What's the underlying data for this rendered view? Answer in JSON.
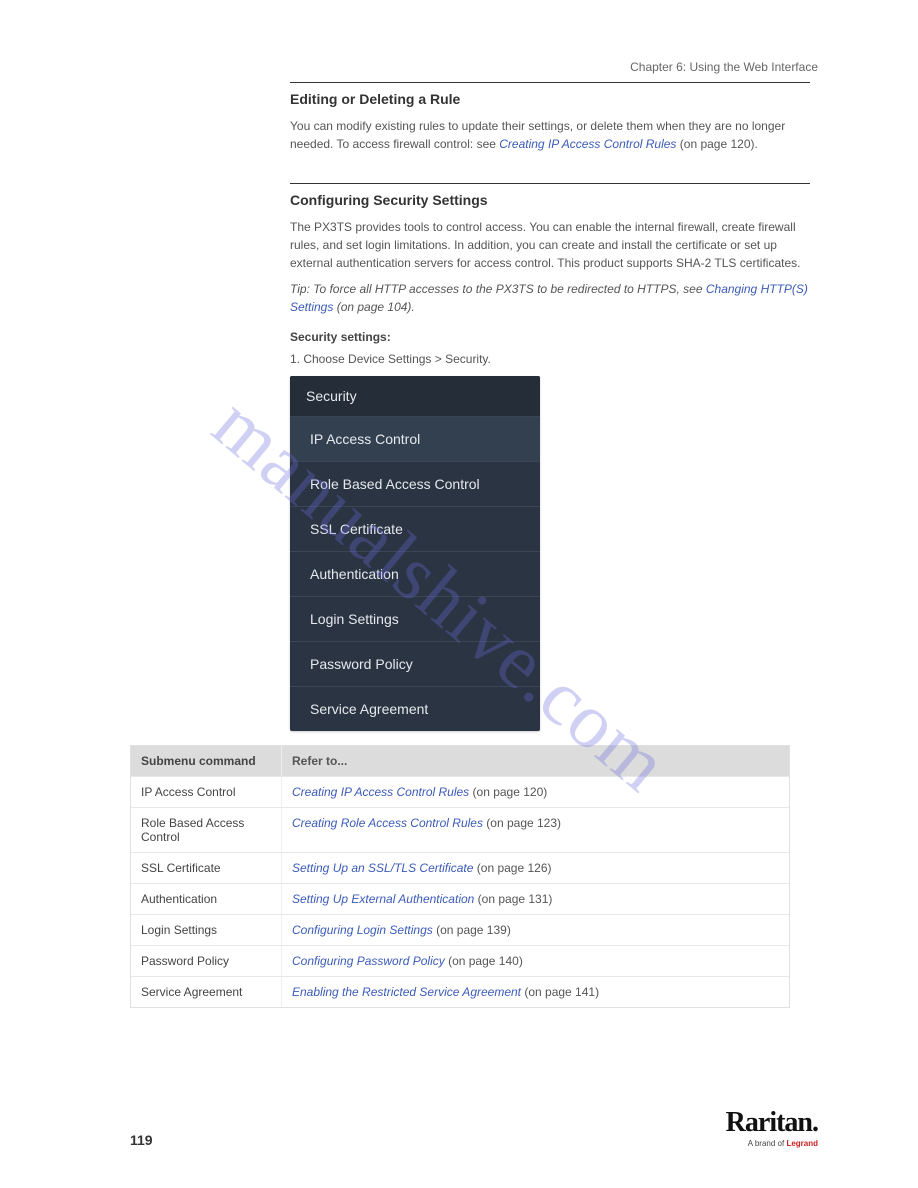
{
  "chapter_label": "Chapter 6: Using the Web Interface",
  "top_empty": "",
  "section1": {
    "title": "Editing or Deleting a Rule",
    "body_prefix": "You can modify existing rules to update their settings, or delete them when they are no longer needed.",
    "body_see": "To access firewall control: see ",
    "body_link": "Creating IP Access Control Rules",
    "body_page": " (on page 120)."
  },
  "section2": {
    "title": "Configuring Security Settings",
    "body1": "The PX3TS provides tools to control access. You can enable the internal firewall, create firewall rules, and set login limitations. In addition, you can create and install the certificate or set up external authentication servers for access control. This product supports SHA-2 TLS certificates.",
    "tip": "Tip: To force all HTTP accesses to the PX3TS to be redirected to HTTPS, see ",
    "tip_link": "Changing HTTP(S) Settings",
    "tip_page": " (on page 104).",
    "subhead": "Security settings:",
    "instruction": "1. Choose Device Settings > Security."
  },
  "menu": {
    "header": "Security",
    "items": [
      "IP Access Control",
      "Role Based Access Control",
      "SSL Certificate",
      "Authentication",
      "Login Settings",
      "Password Policy",
      "Service Agreement"
    ],
    "selected_index": 0
  },
  "table": {
    "headers": [
      "Submenu command",
      "Refer to..."
    ],
    "rows": [
      [
        "IP Access Control",
        {
          "text": "Creating IP Access Control Rules",
          "page": " (on page 120)"
        }
      ],
      [
        "Role Based Access Control",
        {
          "text": "Creating Role Access Control Rules",
          "page": " (on page 123)"
        }
      ],
      [
        "SSL Certificate",
        {
          "text": "Setting Up an SSL/TLS Certificate",
          "page": " (on page 126)"
        }
      ],
      [
        "Authentication",
        {
          "text": "Setting Up External Authentication",
          "page": " (on page 131)"
        }
      ],
      [
        "Login Settings",
        {
          "text": "Configuring Login Settings",
          "page": " (on page 139)"
        }
      ],
      [
        "Password Policy",
        {
          "text": "Configuring Password Policy",
          "page": " (on page 140)"
        }
      ],
      [
        "Service Agreement",
        {
          "text": "Enabling the Restricted Service Agreement",
          "page": " (on page 141)"
        }
      ]
    ]
  },
  "footer": {
    "page_number": "119",
    "logo_main": "Raritan.",
    "logo_sub_prefix": "A brand of ",
    "logo_sub_brand": "Legrand"
  },
  "watermark": "manualshive.com"
}
